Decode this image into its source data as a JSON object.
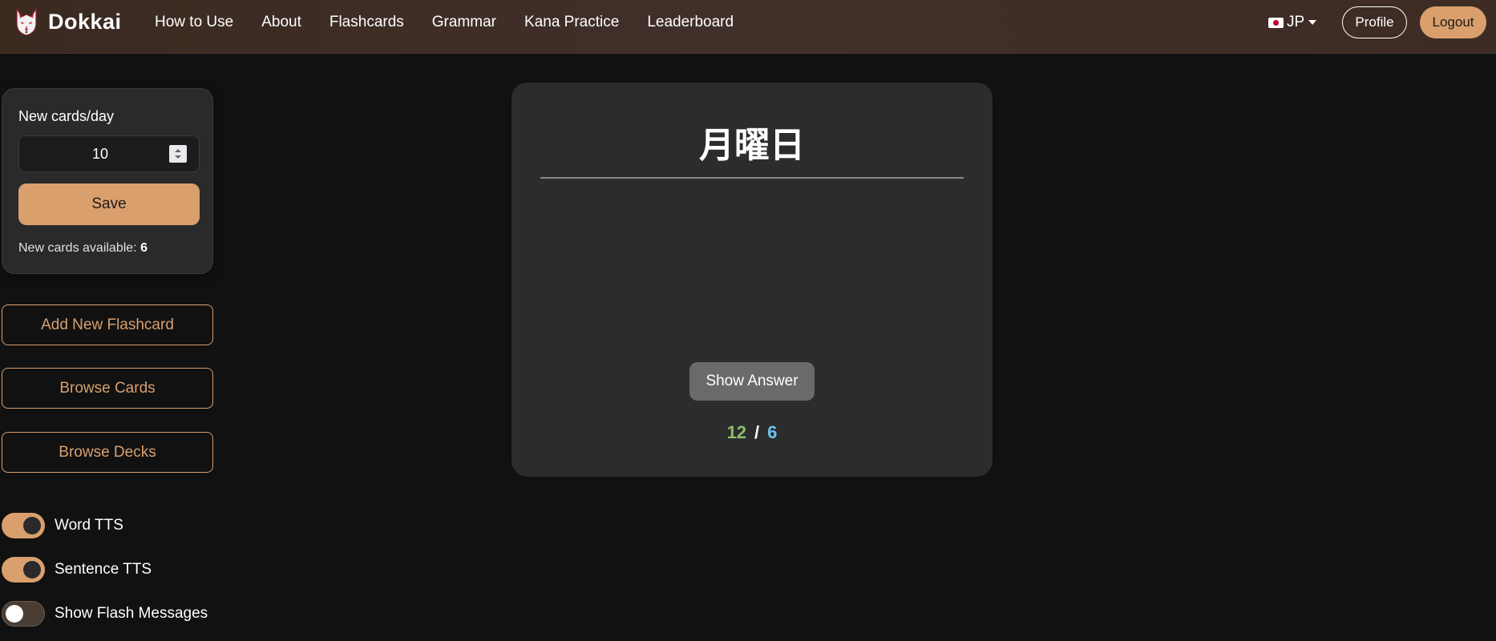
{
  "navbar": {
    "brand": "Dokkai",
    "links": [
      "How to Use",
      "About",
      "Flashcards",
      "Grammar",
      "Kana Practice",
      "Leaderboard"
    ],
    "language": "JP",
    "profile_label": "Profile",
    "logout_label": "Logout"
  },
  "settings": {
    "label": "New cards/day",
    "new_cards_per_day": "10",
    "save_label": "Save",
    "available_label": "New cards available:",
    "available_count": "6"
  },
  "actions": {
    "add_flashcard": "Add New Flashcard",
    "browse_cards": "Browse Cards",
    "browse_decks": "Browse Decks"
  },
  "toggles": [
    {
      "label": "Word TTS",
      "on": true
    },
    {
      "label": "Sentence TTS",
      "on": true
    },
    {
      "label": "Show Flash Messages",
      "on": false
    }
  ],
  "flashcard": {
    "word": "月曜日",
    "show_answer_label": "Show Answer",
    "new_count": "12",
    "separator": "/",
    "due_count": "6"
  },
  "colors": {
    "accent": "#d9a06e",
    "new_count": "#8fbf6e",
    "due_count": "#6ec3f0"
  }
}
